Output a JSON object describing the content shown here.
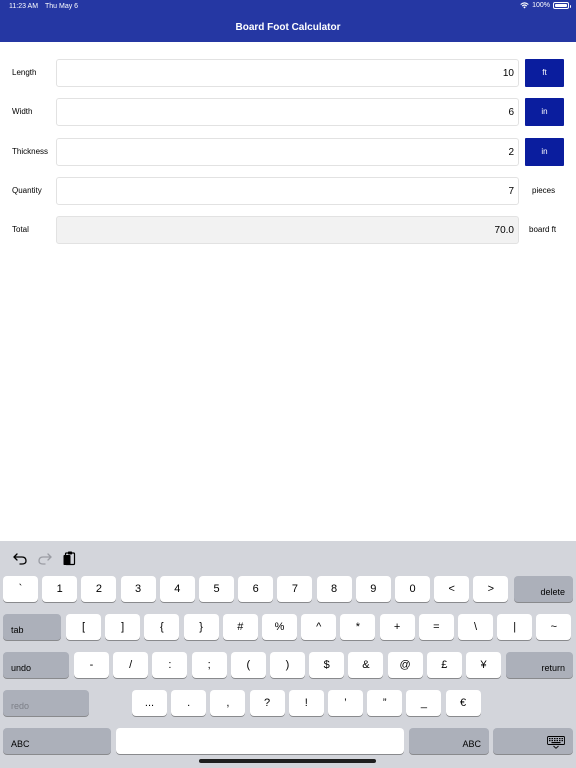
{
  "status_bar": {
    "time": "11:23 AM",
    "date": "Thu May 6",
    "battery": "100%",
    "battery_level": 1.0
  },
  "header": {
    "title": "Board Foot Calculator"
  },
  "form": {
    "rows": [
      {
        "label": "Length",
        "value": "10",
        "unit": "ft"
      },
      {
        "label": "Width",
        "value": "6",
        "unit": "in"
      },
      {
        "label": "Thickness",
        "value": "2",
        "unit": "in"
      },
      {
        "label": "Quantity",
        "value": "7",
        "unit": "pieces"
      },
      {
        "label": "Total",
        "value": "70.0",
        "unit": "board ft"
      }
    ]
  },
  "keyboard": {
    "toolbar_icons": [
      "undo-icon",
      "redo-icon",
      "paste-icon"
    ],
    "row1": [
      "`",
      "1",
      "2",
      "3",
      "4",
      "5",
      "6",
      "7",
      "8",
      "9",
      "0",
      "<",
      ">"
    ],
    "delete": "delete",
    "tab": "tab",
    "row2": [
      "[",
      "]",
      "{",
      "}",
      "#",
      "%",
      "^",
      "*",
      "+",
      "=",
      "\\",
      "|",
      "~"
    ],
    "undo": "undo",
    "row3": [
      "-",
      "/",
      ":",
      ";",
      "(",
      ")",
      "$",
      "&",
      "@",
      "£",
      "¥"
    ],
    "return": "return",
    "redo": "redo",
    "row4": [
      "...",
      ".",
      ",",
      "?",
      "!",
      "’",
      "”",
      "_",
      "€"
    ],
    "abc_left": "ABC",
    "abc_right": "ABC",
    "dismiss_icon": "keyboard-dismiss-icon"
  }
}
